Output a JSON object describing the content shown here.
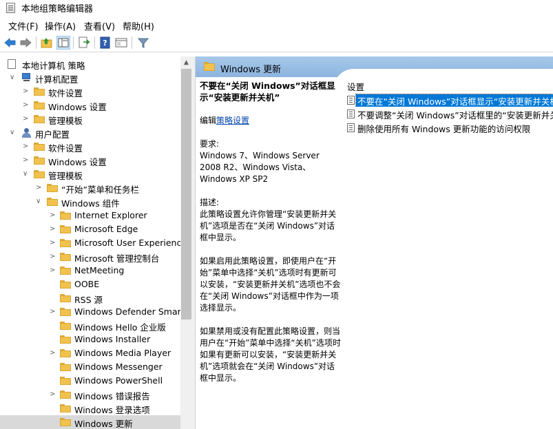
{
  "window": {
    "title": "本地组策略编辑器"
  },
  "menu": [
    "文件(F)",
    "操作(A)",
    "查看(V)",
    "帮助(H)"
  ],
  "toolbar_icons": [
    "back-arrow-icon",
    "forward-arrow-icon",
    "up-folder-icon",
    "show-hide-tree-icon",
    "export-list-icon",
    "help-icon",
    "properties-icon",
    "filter-icon"
  ],
  "tree": {
    "root": "本地计算机 策略",
    "computer_config": "计算机配置",
    "computer_children": [
      "软件设置",
      "Windows 设置",
      "管理模板"
    ],
    "user_config": "用户配置",
    "user_children": [
      "软件设置",
      "Windows 设置",
      "管理模板"
    ],
    "admin_children": [
      "“开始”菜单和任务栏",
      "Windows 组件"
    ],
    "components": [
      "Internet Explorer",
      "Microsoft Edge",
      "Microsoft User Experience",
      "Microsoft 管理控制台",
      "NetMeeting",
      "OOBE",
      "RSS 源",
      "Windows Defender SmartS",
      "Windows Hello 企业版",
      "Windows Installer",
      "Windows Media Player",
      "Windows Messenger",
      "Windows PowerShell",
      "Windows 错误报告",
      "Windows 登录选项",
      "Windows 更新"
    ]
  },
  "right": {
    "header": "Windows 更新",
    "policy_title": "不要在“关闭 Windows”对话框显示“安装更新并关机”",
    "edit_prefix": "编辑",
    "edit_link": "策略设置",
    "req_label": "要求:",
    "req_text": "Windows 7、Windows Server 2008 R2、Windows Vista、Windows XP SP2",
    "desc_label": "描述:",
    "desc1": "此策略设置允许你管理“安装更新并关机”选项是否在“关闭 Windows”对话框中显示。",
    "desc2": "如果启用此策略设置，即使用户在“开始”菜单中选择“关机”选项时有更新可以安装，“安装更新并关机”选项也不会在“关闭 Windows”对话框中作为一项选择显示。",
    "desc3": "如果禁用或没有配置此策略设置，则当用户在“开始”菜单中选择“关机”选项时如果有更新可以安装，“安装更新并关机”选项就会在“关闭 Windows”对话框中显示。",
    "settings_header": "设置",
    "settings": [
      "不要在“关闭 Windows”对话框显示“安装更新并关机”",
      "不要调整“关闭 Windows”对话框里的“安装更新并关机",
      "删除使用所有 Windows 更新功能的访问权限"
    ]
  }
}
